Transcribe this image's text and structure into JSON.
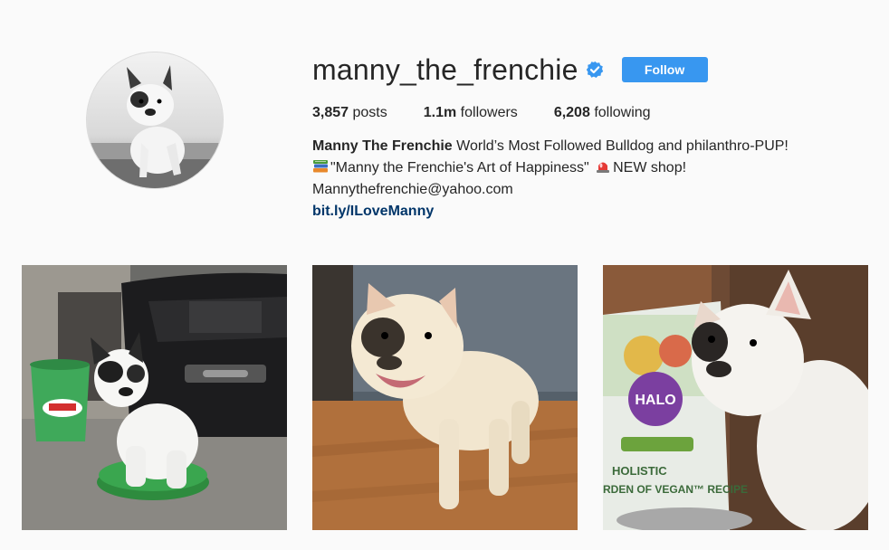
{
  "profile": {
    "username": "manny_the_frenchie",
    "verified": true,
    "follow_label": "Follow",
    "stats": {
      "posts_count": "3,857",
      "posts_label": "posts",
      "followers_count": "1.1m",
      "followers_label": "followers",
      "following_count": "6,208",
      "following_label": "following"
    },
    "bio": {
      "name": "Manny The Frenchie",
      "line1": "World’s Most Followed Bulldog and philanthro-PUP!",
      "line2_book": "\"Manny the Frenchie's Art of Happiness\"",
      "line2_shop": "NEW shop!",
      "email": "Mannythefrenchie@yahoo.com",
      "link": "bit.ly/ILoveManny"
    }
  },
  "icons": {
    "verified": "verified-badge-icon",
    "book": "books-emoji-icon",
    "siren": "siren-emoji-icon"
  },
  "posts": [
    {
      "alt": "bulldog-on-green-bucket-lid"
    },
    {
      "alt": "bulldog-smiling-on-wood-floor"
    },
    {
      "alt": "bulldog-next-to-halo-dog-food-bag",
      "bag_brand": "HALO",
      "bag_text1": "HOLISTIC",
      "bag_text2": "RDEN OF VEGAN™ RECIPE"
    }
  ],
  "colors": {
    "accent": "#3897f0",
    "link": "#003569",
    "background": "#fafafa"
  }
}
